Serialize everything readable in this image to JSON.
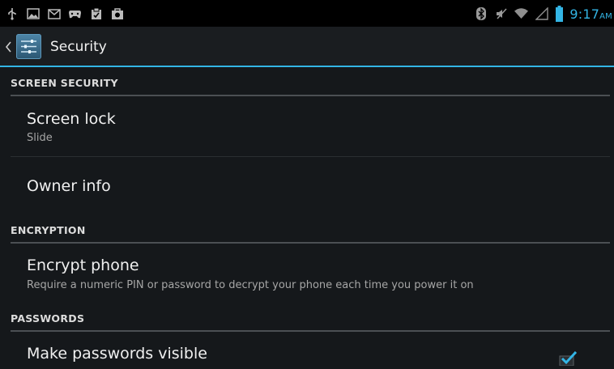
{
  "status_bar": {
    "left_icons": [
      "usb-icon",
      "image-icon",
      "mail-icon",
      "game-controller-icon",
      "clipboard-icon",
      "camera-bag-icon"
    ],
    "right_icons": [
      "bluetooth-icon",
      "mute-icon",
      "wifi-icon",
      "signal-icon",
      "battery-icon"
    ],
    "time": "9:17",
    "ampm": "AM",
    "accent_color": "#33b5e5"
  },
  "action_bar": {
    "title": "Security",
    "icon": "settings-icon"
  },
  "sections": {
    "screen_security": {
      "header": "SCREEN SECURITY",
      "screen_lock_title": "Screen lock",
      "screen_lock_value": "Slide",
      "owner_info_title": "Owner info"
    },
    "encryption": {
      "header": "ENCRYPTION",
      "encrypt_title": "Encrypt phone",
      "encrypt_summary": "Require a numeric PIN or password to decrypt your phone each time you power it on"
    },
    "passwords": {
      "header": "PASSWORDS",
      "visible_title": "Make passwords visible",
      "visible_checked": true
    }
  }
}
